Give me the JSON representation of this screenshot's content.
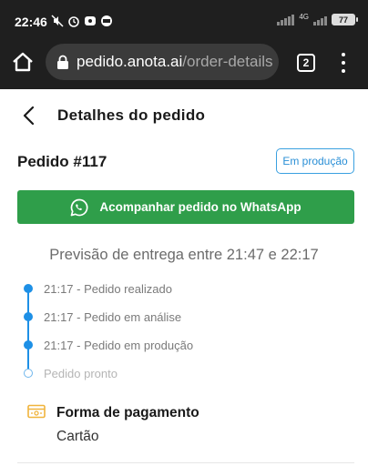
{
  "status_bar": {
    "time": "22:46",
    "network": "4G",
    "battery": "77"
  },
  "browser": {
    "url_domain": "pedido.anota.ai",
    "url_path": "/order-details",
    "tab_count": "2"
  },
  "header": {
    "title": "Detalhes do pedido"
  },
  "order": {
    "number": "Pedido #117",
    "status": "Em produção"
  },
  "whatsapp": {
    "label": "Acompanhar pedido no WhatsApp",
    "color": "#2f9e4a"
  },
  "delivery": {
    "estimate": "Previsão de entrega entre 21:47 e 22:17"
  },
  "timeline": [
    {
      "label": "21:17 - Pedido realizado",
      "done": true
    },
    {
      "label": "21:17 - Pedido em análise",
      "done": true
    },
    {
      "label": "21:17 - Pedido em produção",
      "done": true
    },
    {
      "label": "Pedido pronto",
      "done": false
    }
  ],
  "payment": {
    "title": "Forma de pagamento",
    "method": "Cartão",
    "icon": "card-icon"
  },
  "colors": {
    "accent": "#1e90e6",
    "whatsapp_green": "#2f9e4a",
    "status_bar": "#1f1f1f"
  }
}
